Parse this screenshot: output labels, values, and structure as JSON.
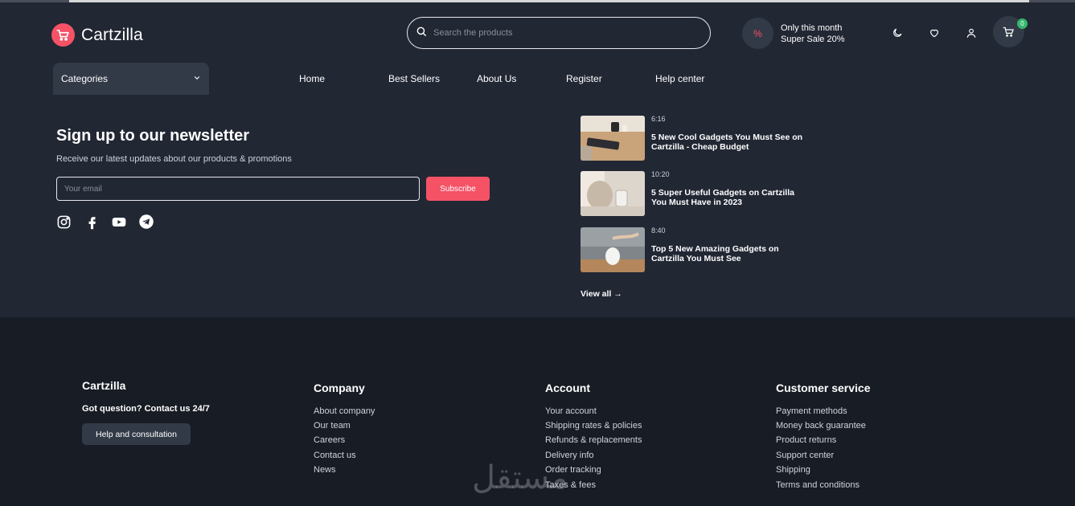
{
  "brand": {
    "name": "Cartzilla"
  },
  "search": {
    "placeholder": "Search the products"
  },
  "promo": {
    "badge": "%",
    "line1": "Only this month",
    "line2": "Super Sale 20%"
  },
  "cart": {
    "count": "0"
  },
  "categories": {
    "label": "Categories"
  },
  "nav": [
    "Home",
    "Best Sellers",
    "About Us",
    "Register",
    "Help center"
  ],
  "newsletter": {
    "title": "Sign up to our newsletter",
    "subtitle": "Receive our latest updates about our products & promotions",
    "email_placeholder": "Your email",
    "subscribe_label": "Subscribe"
  },
  "social": [
    "instagram-icon",
    "facebook-icon",
    "youtube-icon",
    "telegram-icon"
  ],
  "posts": [
    {
      "time": "6:16",
      "title": "5 New Cool Gadgets You Must See on Cartzilla - Cheap Budget"
    },
    {
      "time": "10:20",
      "title": "5 Super Useful Gadgets on Cartzilla You Must Have in 2023"
    },
    {
      "time": "8:40",
      "title": "Top 5 New Amazing Gadgets on Cartzilla You Must See"
    }
  ],
  "view_all": "View all →",
  "footer": {
    "brand": "Cartzilla",
    "question": "Got question? Contact us 24/7",
    "help_button": "Help and consultation",
    "columns": [
      {
        "title": "Company",
        "links": [
          "About company",
          "Our team",
          "Careers",
          "Contact us",
          "News"
        ]
      },
      {
        "title": "Account",
        "links": [
          "Your account",
          "Shipping rates & policies",
          "Refunds & replacements",
          "Delivery info",
          "Order tracking",
          "Taxes & fees"
        ]
      },
      {
        "title": "Customer service",
        "links": [
          "Payment methods",
          "Money back guarantee",
          "Product returns",
          "Support center",
          "Shipping",
          "Terms and conditions"
        ]
      }
    ]
  },
  "watermark": "مستقل",
  "colors": {
    "accent": "#f55266",
    "background": "#222734",
    "footer": "#181c25",
    "badge": "#34b76c"
  }
}
